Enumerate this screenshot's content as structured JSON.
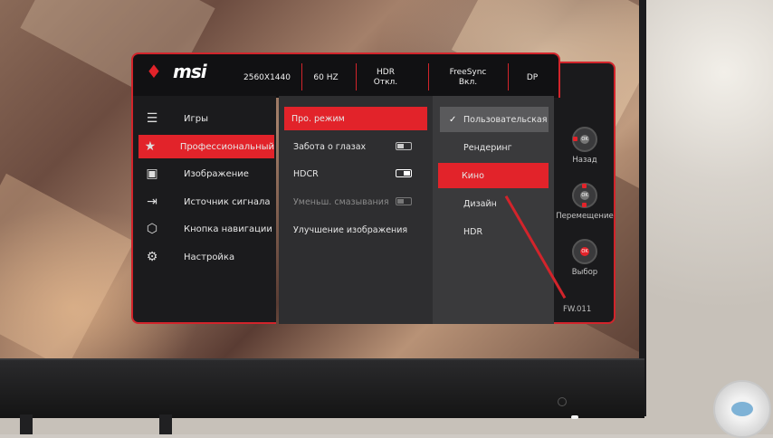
{
  "brand": {
    "logo_text": "msi"
  },
  "status_bar": [
    {
      "label": "2560X1440"
    },
    {
      "label": "60 HZ"
    },
    {
      "label": "HDR\nОткл."
    },
    {
      "label": "FreeSync\nВкл."
    },
    {
      "label": "DP"
    }
  ],
  "sidebar": {
    "items": [
      {
        "label": "Игры",
        "icon": "gamepad-icon"
      },
      {
        "label": "Профессиональный",
        "icon": "star-icon",
        "active": true
      },
      {
        "label": "Изображение",
        "icon": "image-icon"
      },
      {
        "label": "Источник сигнала",
        "icon": "input-source-icon"
      },
      {
        "label": "Кнопка навигации",
        "icon": "navigation-key-icon"
      },
      {
        "label": "Настройка",
        "icon": "gear-icon"
      }
    ]
  },
  "pro_menu": {
    "items": [
      {
        "label": "Про. режим",
        "active": true
      },
      {
        "label": "Забота о глазах",
        "toggle": "off"
      },
      {
        "label": "HDCR",
        "toggle": "on"
      },
      {
        "label": "Уменьш. смазывания",
        "toggle": "off",
        "disabled": true
      },
      {
        "label": "Улучшение изображения"
      }
    ]
  },
  "pro_modes": {
    "items": [
      {
        "label": "Пользовательская",
        "checked": true
      },
      {
        "label": "Рендеринг"
      },
      {
        "label": "Кино",
        "highlighted": true
      },
      {
        "label": "Дизайн"
      },
      {
        "label": "HDR"
      }
    ]
  },
  "navigation": {
    "back_label": "Назад",
    "move_label": "Перемещение",
    "select_label": "Выбор",
    "ok_label": "OK"
  },
  "firmware": "FW.011",
  "colors": {
    "accent": "#e2232a",
    "panel": "#1b1b1d"
  }
}
